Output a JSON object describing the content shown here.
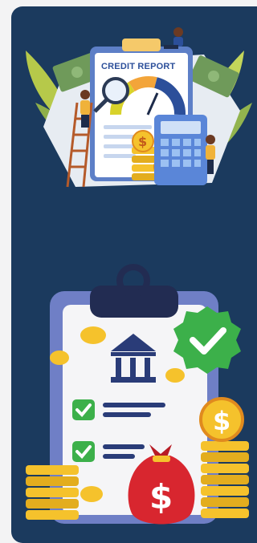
{
  "credit_report": {
    "title": "CREDIT REPORT",
    "coin_symbol": "$"
  },
  "approval": {
    "bag_symbol": "$",
    "coin_symbol": "$",
    "list_items_checked": 2
  },
  "colors": {
    "card_background": "#1b3a5e",
    "page_background": "#f3f3f4",
    "accent_blue": "#2c4f9a",
    "coin_gold": "#f5c22c",
    "check_green": "#3cb04a",
    "bag_red": "#d8262f"
  }
}
